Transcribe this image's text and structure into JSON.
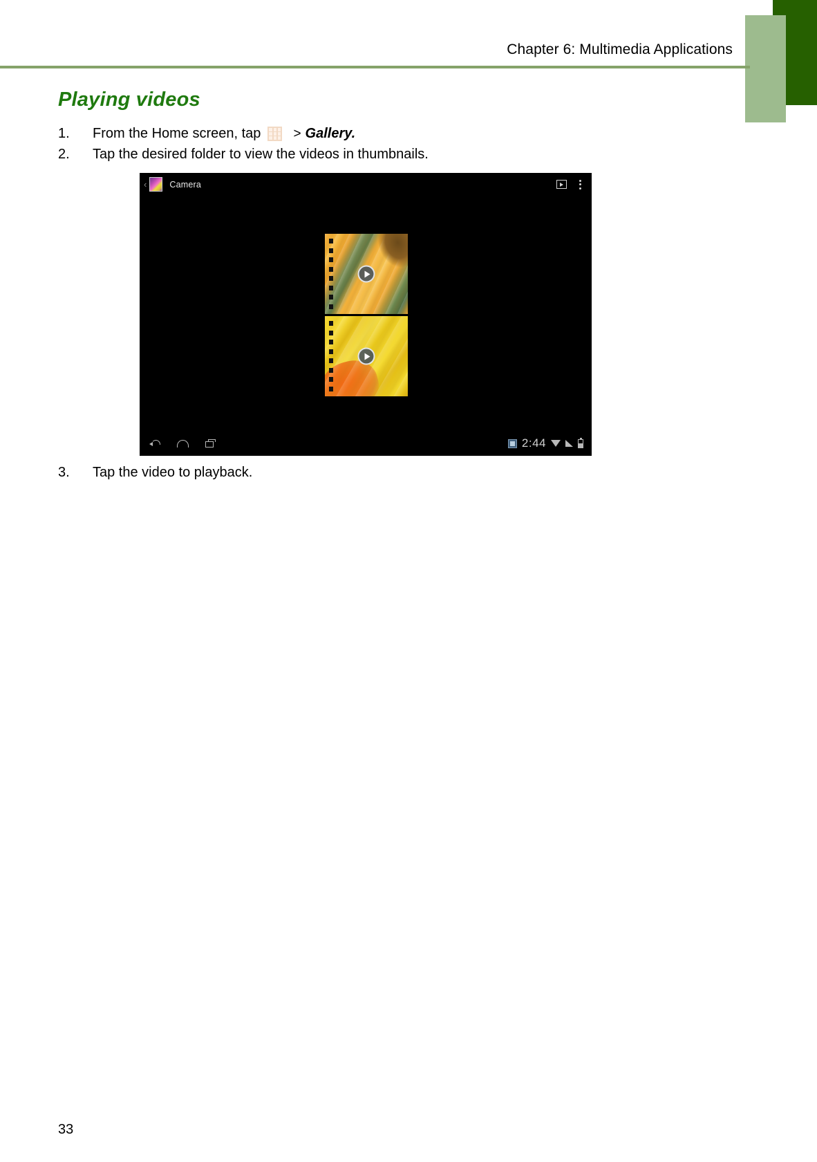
{
  "document": {
    "running_head": "Chapter 6: Multimedia Applications",
    "section_title": "Playing videos",
    "page_number": "33",
    "accent_colors": {
      "rule": "#85a36a",
      "deco_dark": "#266000",
      "deco_light": "#9dbb8e",
      "heading": "#1f7a0f"
    }
  },
  "steps": [
    {
      "number": "1.",
      "text_before_icon": "From the Home screen, tap",
      "icon": "apps-grid-icon",
      "separator": ">",
      "emphasis": "Gallery."
    },
    {
      "number": "2.",
      "text": "Tap the desired folder to view the videos in thumbnails."
    },
    {
      "number": "3.",
      "text": "Tap the video to playback."
    }
  ],
  "screenshot": {
    "action_bar": {
      "up_caret": "‹",
      "app_icon": "gallery-app-icon",
      "title": "Camera",
      "slideshow_icon": "slideshow-icon",
      "overflow_icon": "overflow-menu-icon"
    },
    "thumbnails": [
      {
        "label": "video-thumbnail-sunflower",
        "play_icon": "play-icon"
      },
      {
        "label": "video-thumbnail-yellow-leaves",
        "play_icon": "play-icon"
      }
    ],
    "system_bar": {
      "back_icon": "back-icon",
      "home_icon": "home-icon",
      "recents_icon": "recents-icon",
      "screenshot_icon": "screenshot-icon",
      "clock": "2:44",
      "wifi_icon": "wifi-icon",
      "signal_icon": "signal-icon",
      "battery_icon": "battery-icon"
    }
  }
}
